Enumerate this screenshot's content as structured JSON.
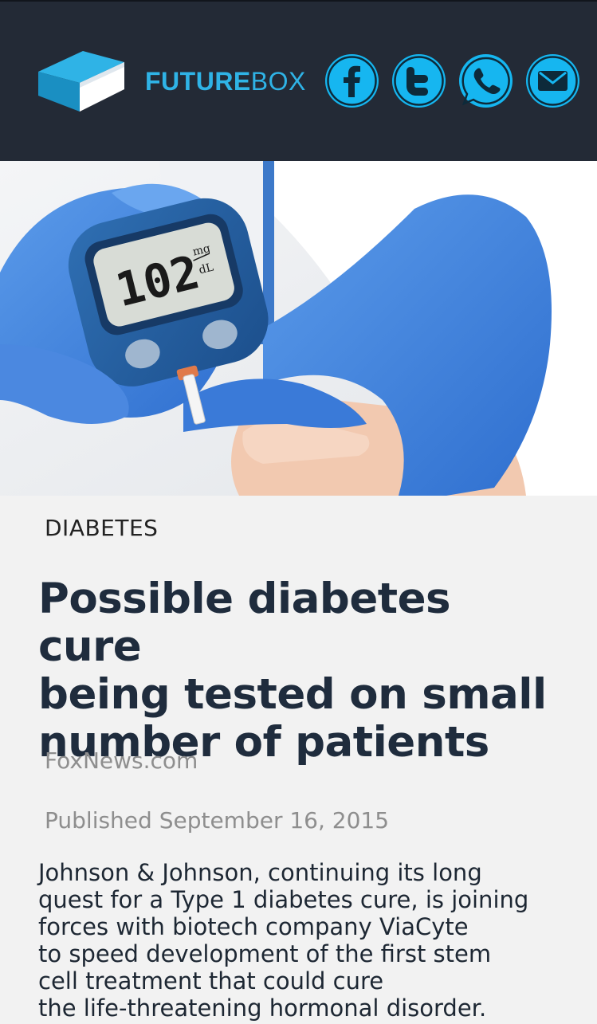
{
  "header": {
    "brand_bold": "FUTURE",
    "brand_light": "BOX",
    "colors": {
      "background": "#232a36",
      "accent": "#16b6f0"
    },
    "social": [
      {
        "name": "facebook-icon"
      },
      {
        "name": "twitter-icon"
      },
      {
        "name": "whatsapp-icon"
      },
      {
        "name": "email-icon"
      }
    ]
  },
  "hero": {
    "meter_reading": "102",
    "meter_unit_top": "mg",
    "meter_unit_bottom": "dL"
  },
  "article": {
    "category": "DIABETES",
    "title_lines": [
      "Possible diabetes cure",
      "being tested on small",
      "number of patients"
    ],
    "source": "FoxNews.com",
    "published": "Published September 16, 2015",
    "body_lines": [
      "Johnson & Johnson, continuing its long",
      "quest for a Type 1 diabetes cure, is joining",
      "forces with biotech company ViaCyte",
      "to speed development of the first stem",
      "cell treatment that could cure",
      "the life-threatening hormonal disorder."
    ]
  }
}
